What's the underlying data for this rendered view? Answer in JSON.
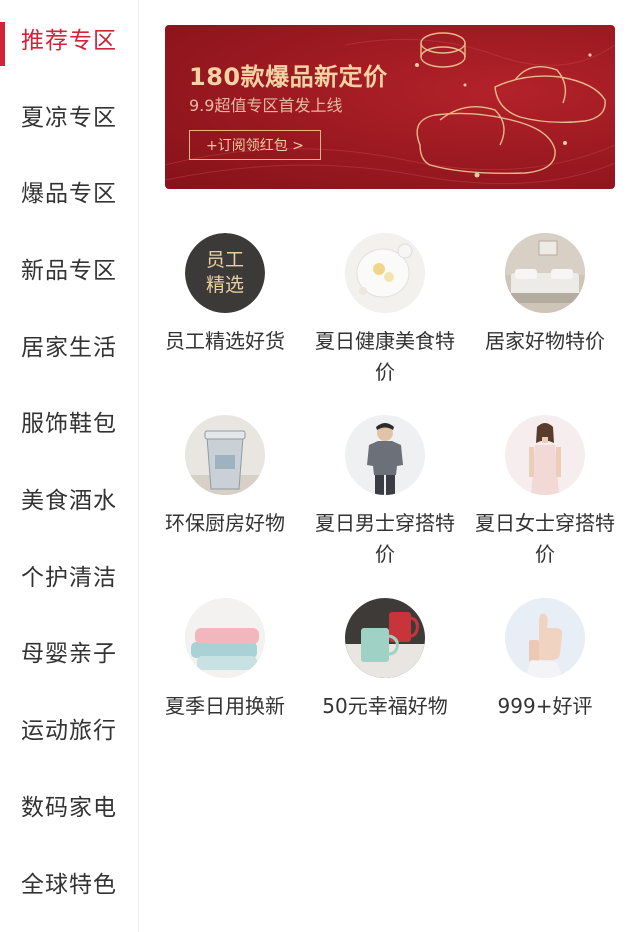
{
  "sidebar": {
    "items": [
      {
        "label": "推荐专区",
        "active": true
      },
      {
        "label": "夏凉专区"
      },
      {
        "label": "爆品专区"
      },
      {
        "label": "新品专区"
      },
      {
        "label": "居家生活"
      },
      {
        "label": "服饰鞋包"
      },
      {
        "label": "美食酒水"
      },
      {
        "label": "个护清洁"
      },
      {
        "label": "母婴亲子"
      },
      {
        "label": "运动旅行"
      },
      {
        "label": "数码家电"
      },
      {
        "label": "全球特色"
      }
    ]
  },
  "banner": {
    "title": "180款爆品新定价",
    "subtitle": "9.9超值专区首发上线",
    "button_label": "+订阅领红包 >"
  },
  "tiles": [
    {
      "label": "员工精选好货",
      "image_text": [
        "员工",
        "精选"
      ]
    },
    {
      "label": "夏日健康美食特价"
    },
    {
      "label": "居家好物特价"
    },
    {
      "label": "环保厨房好物"
    },
    {
      "label": "夏日男士穿搭特价"
    },
    {
      "label": "夏日女士穿搭特价"
    },
    {
      "label": "夏季日用换新"
    },
    {
      "label": "50元幸福好物"
    },
    {
      "label": "999+好评"
    }
  ],
  "colors": {
    "accent": "#d2233a",
    "banner_gold": "#f3d3a4"
  }
}
